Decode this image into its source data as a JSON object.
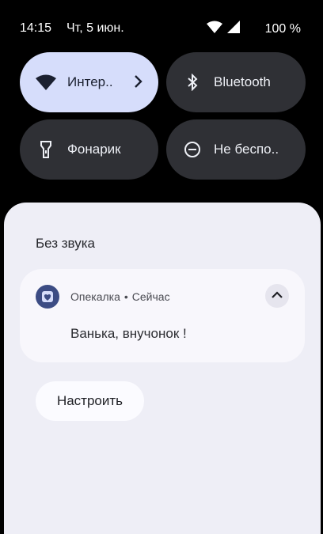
{
  "status_bar": {
    "time": "14:15",
    "date": "Чт, 5 июн.",
    "battery": "100 %",
    "icons": [
      "wifi-icon",
      "cellular-signal-icon"
    ]
  },
  "quick_settings": {
    "tiles": [
      {
        "label": "Интер..",
        "icon": "wifi-icon",
        "state": "active",
        "has_chevron": true
      },
      {
        "label": "Bluetooth",
        "icon": "bluetooth-icon",
        "state": "inactive"
      },
      {
        "label": "Фонарик",
        "icon": "flashlight-icon",
        "state": "inactive"
      },
      {
        "label": "Не беспо..",
        "icon": "do-not-disturb-icon",
        "state": "inactive"
      }
    ]
  },
  "notifications": {
    "section_title": "Без звука",
    "items": [
      {
        "app_name": "Опекалка",
        "separator": "•",
        "time": "Сейчас",
        "message": "Ванька, внучонок !",
        "icon": "app-icon"
      }
    ],
    "settings_button": "Настроить"
  },
  "colors": {
    "background": "#000000",
    "tile_dark": "#2f3035",
    "tile_active": "#d6ddfb",
    "panel": "#eeeef6",
    "card": "#f8f7fc",
    "app_icon": "#3c4c84"
  }
}
